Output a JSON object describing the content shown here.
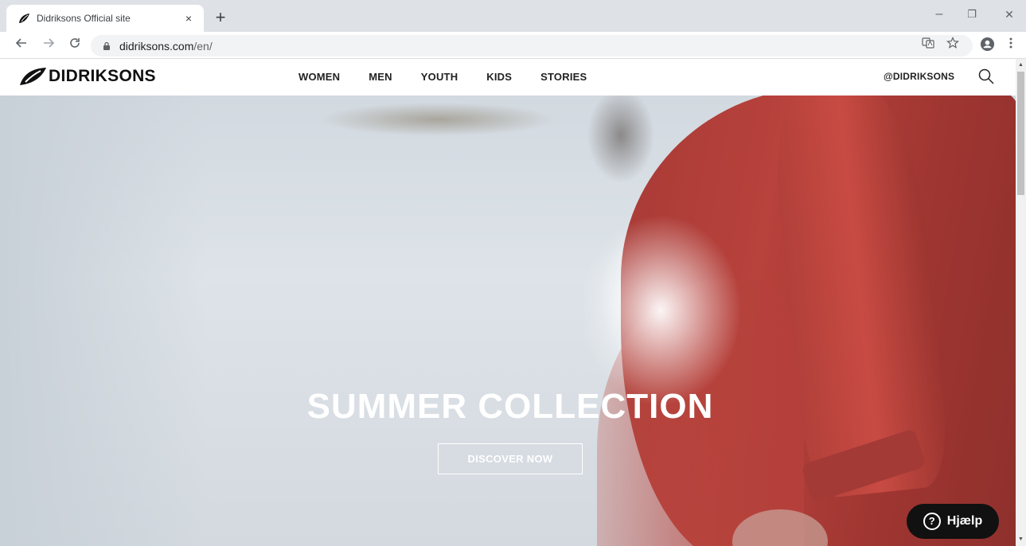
{
  "browser": {
    "tab_title": "Didriksons Official site",
    "tab_close": "×",
    "new_tab": "+",
    "url_host": "didriksons.com",
    "url_path": "/en/",
    "window_minimize": "–",
    "window_restore": "❐",
    "window_close": "✕"
  },
  "site": {
    "logo_text": "DIDRIKSONS",
    "nav": [
      "WOMEN",
      "MEN",
      "YOUTH",
      "KIDS",
      "STORIES"
    ],
    "social": "@DIDRIKSONS"
  },
  "hero": {
    "title": "SUMMER COLLECTION",
    "cta": "DISCOVER NOW"
  },
  "help": {
    "label": "Hjælp",
    "icon": "?"
  },
  "colors": {
    "coat_red": "#b8423c",
    "help_bg": "#111111"
  }
}
